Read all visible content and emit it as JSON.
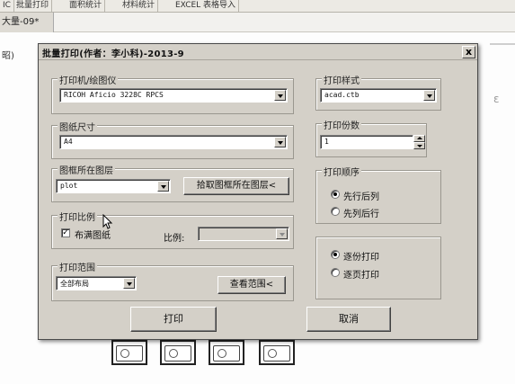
{
  "app": {
    "menu": [
      "IC",
      "批量打印",
      "面积统计",
      "材料统计",
      "EXCEL 表格导入"
    ],
    "doc_tab": "大量-09*",
    "left_fragment": "昭)"
  },
  "dialog": {
    "title": "批量打印(作者：李小科)-2013-9",
    "close_label": "x",
    "printer": {
      "legend": "打印机/绘图仪",
      "value": "RICOH Aficio 3228C RPCS"
    },
    "paper": {
      "legend": "图纸尺寸",
      "value": "A4"
    },
    "frame_layer": {
      "legend": "图框所在图层",
      "value": "plot",
      "pick_button": "拾取图框所在图层<"
    },
    "scale": {
      "legend": "打印比例",
      "fit_label": "布满图纸",
      "fit_checked": true,
      "scale_label": "比例:",
      "scale_value": ""
    },
    "range": {
      "legend": "打印范围",
      "value": "全部布局",
      "view_button": "查看范围<"
    },
    "style": {
      "legend": "打印样式",
      "value": "acad.ctb"
    },
    "copies": {
      "legend": "打印份数",
      "value": "1"
    },
    "order": {
      "legend": "打印顺序",
      "options": [
        "先行后列",
        "先列后行"
      ],
      "selected": 0
    },
    "mode": {
      "options": [
        "逐份打印",
        "逐页打印"
      ],
      "selected": 0
    },
    "print_button": "打印",
    "cancel_button": "取消"
  }
}
